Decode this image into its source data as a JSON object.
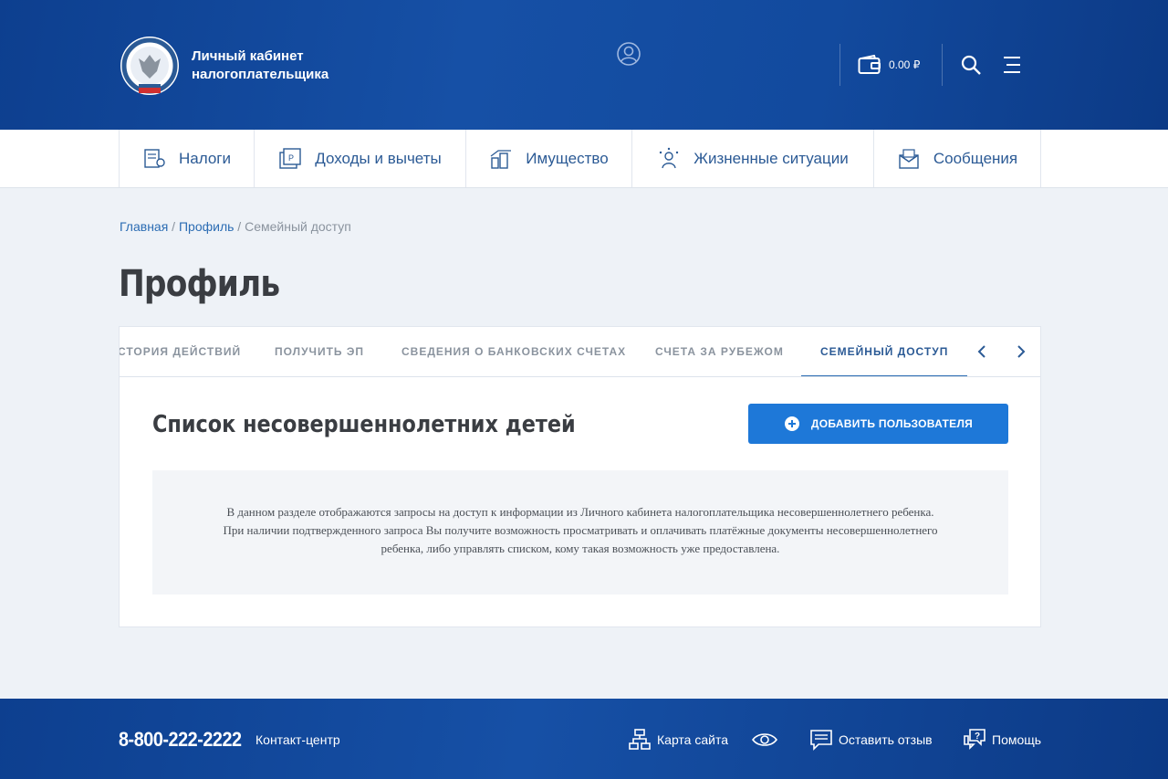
{
  "header": {
    "logo_text_line1": "Личный кабинет",
    "logo_text_line2": "налогоплательщика",
    "balance": "0.00 ₽"
  },
  "nav": {
    "items": [
      {
        "label": "Налоги",
        "icon": "taxes-icon"
      },
      {
        "label": "Доходы и вычеты",
        "icon": "income-icon"
      },
      {
        "label": "Имущество",
        "icon": "property-icon"
      },
      {
        "label": "Жизненные ситуации",
        "icon": "life-situations-icon"
      },
      {
        "label": "Сообщения",
        "icon": "messages-icon"
      }
    ]
  },
  "breadcrumb": {
    "home": "Главная",
    "sep1": " / ",
    "profile": "Профиль",
    "sep2": " / ",
    "current": "Семейный доступ"
  },
  "page_title": "Профиль",
  "tabs": {
    "items": [
      "СТОРИЯ ДЕЙСТВИЙ",
      "ПОЛУЧИТЬ ЭП",
      "СВЕДЕНИЯ О БАНКОВСКИХ СЧЕТАХ",
      "СЧЕТА ЗА РУБЕЖОМ",
      "СЕМЕЙНЫЙ ДОСТУП"
    ],
    "active": "СЕМЕЙНЫЙ ДОСТУП"
  },
  "section": {
    "title": "Список несовершеннолетних детей",
    "add_button": "ДОБАВИТЬ ПОЛЬЗОВАТЕЛЯ",
    "info_line1": "В данном разделе отображаются запросы на доступ к информации из Личного кабинета налогоплательщика несовершеннолетнего ребенка.",
    "info_line2": "При наличии подтвержденного запроса Вы получите возможность просматривать и оплачивать платёжные документы несовершеннолетнего",
    "info_line3": "ребенка, либо управлять списком, кому такая возможность уже предоставлена."
  },
  "footer": {
    "phone": "8-800-222-2222",
    "contact": "Контакт-центр",
    "sitemap": "Карта сайта",
    "feedback": "Оставить отзыв",
    "help": "Помощь"
  },
  "colors": {
    "header_blue": "#1650a6",
    "accent": "#1e78d8",
    "link": "#2b6cb3"
  }
}
